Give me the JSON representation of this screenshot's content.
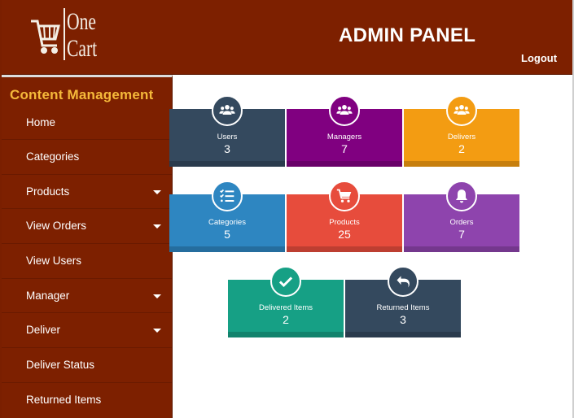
{
  "header": {
    "logo_line1": "One",
    "logo_line2": "Cart",
    "title": "ADMIN PANEL",
    "logout_label": "Logout"
  },
  "sidebar": {
    "title": "Content Management",
    "items": [
      {
        "label": "Home",
        "dropdown": false
      },
      {
        "label": "Categories",
        "dropdown": false
      },
      {
        "label": "Products",
        "dropdown": true
      },
      {
        "label": "View Orders",
        "dropdown": true
      },
      {
        "label": "View Users",
        "dropdown": false
      },
      {
        "label": "Manager",
        "dropdown": true
      },
      {
        "label": "Deliver",
        "dropdown": true
      },
      {
        "label": "Deliver Status",
        "dropdown": false
      },
      {
        "label": "Returned Items",
        "dropdown": false
      }
    ]
  },
  "cards": [
    {
      "label": "Users",
      "count": "3",
      "icon": "users-icon",
      "color": "#34495e"
    },
    {
      "label": "Managers",
      "count": "7",
      "icon": "users-icon",
      "color": "#800080"
    },
    {
      "label": "Delivers",
      "count": "2",
      "icon": "users-icon",
      "color": "#f39c12"
    },
    {
      "label": "Categories",
      "count": "5",
      "icon": "list-icon",
      "color": "#2e86c1"
    },
    {
      "label": "Products",
      "count": "25",
      "icon": "cart-icon",
      "color": "#e74c3c"
    },
    {
      "label": "Orders",
      "count": "7",
      "icon": "bell-icon",
      "color": "#8e44ad"
    },
    {
      "label": "Delivered Items",
      "count": "2",
      "icon": "check-icon",
      "color": "#16a085"
    },
    {
      "label": "Returned Items",
      "count": "3",
      "icon": "return-icon",
      "color": "#34495e"
    }
  ],
  "colors": {
    "header_bg": "#7d2000",
    "sidebar_title": "#f5b93a"
  }
}
